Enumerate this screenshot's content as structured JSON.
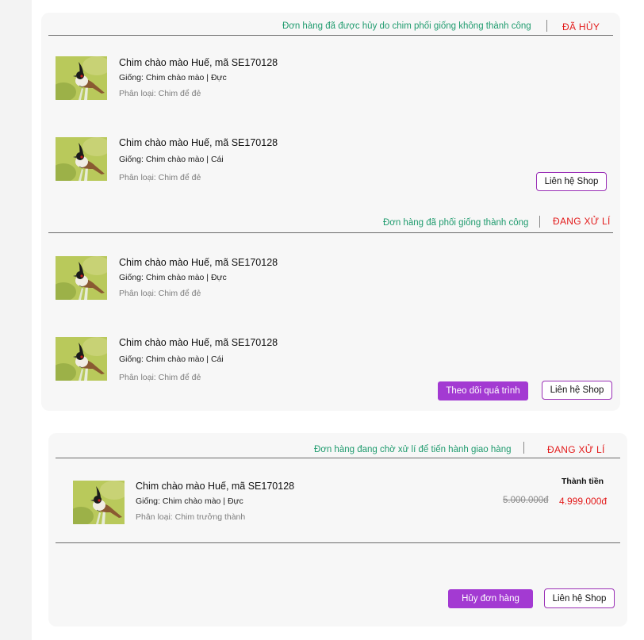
{
  "orders": [
    {
      "status_message": "Đơn hàng đã được hủy do chim phối giống không thành công",
      "status": "ĐÃ HỦY",
      "items": [
        {
          "name": "Chim chào mào Huế, mã SE170128",
          "breed": "Giống: Chim chào mào | Đực",
          "category": "Phân loại: Chim để đẻ"
        },
        {
          "name": "Chim chào mào Huế, mã SE170128",
          "breed": "Giống: Chim chào mào | Cái",
          "category": "Phân loại: Chim để đẻ"
        }
      ],
      "contact_label": "Liên hệ Shop"
    },
    {
      "status_message": "Đơn hàng đã phối giống thành công",
      "status": "ĐANG XỬ LÍ",
      "items": [
        {
          "name": "Chim chào mào Huế, mã SE170128",
          "breed": "Giống: Chim chào mào | Đực",
          "category": "Phân loại: Chim để đẻ"
        },
        {
          "name": "Chim chào mào Huế, mã SE170128",
          "breed": "Giống: Chim chào mào | Cái",
          "category": "Phân loại: Chim để đẻ"
        }
      ],
      "track_label": "Theo dõi quá trình",
      "contact_label": "Liên hệ Shop"
    },
    {
      "status_message": "Đơn hàng đang chờ xử lí để tiến hành giao hàng",
      "status": "ĐANG XỬ LÍ",
      "items": [
        {
          "name": "Chim chào mào Huế, mã SE170128",
          "breed": "Giống: Chim chào mào | Đực",
          "category": "Phân loại: Chim trưởng thành"
        }
      ],
      "total_label": "Thành tiền",
      "original_price": "5.000.000đ",
      "sale_price": "4.999.000đ",
      "cancel_label": "Hủy đơn hàng",
      "contact_label": "Liên hệ Shop"
    }
  ],
  "colors": {
    "status_message": "#1f9b6e",
    "status_label": "#e31b1b",
    "accent": "#a33ad2",
    "card_bg": "#f7f7f7"
  },
  "icons": {
    "product_thumbnail": "bird-photo"
  }
}
